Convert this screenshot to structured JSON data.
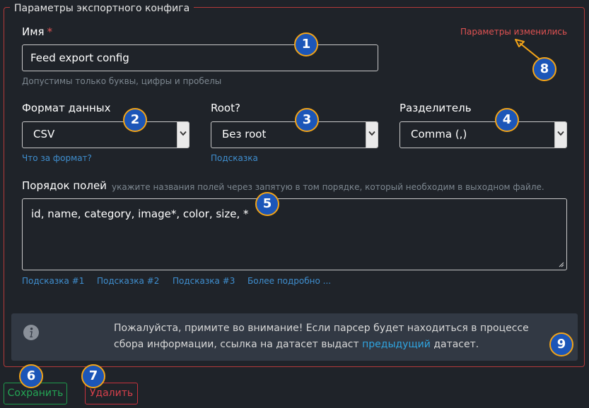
{
  "form": {
    "legend": "Параметры экспортного конфига",
    "changed_notice": "Параметры изменились",
    "name": {
      "label": "Имя",
      "required_mark": "*",
      "value": "Feed export config",
      "help": "Допустимы только буквы, цифры и пробелы"
    },
    "format": {
      "label": "Формат данных",
      "selected": "CSV",
      "help_link": "Что за формат?"
    },
    "root": {
      "label": "Root?",
      "selected": "Без root",
      "help_link": "Подсказка"
    },
    "separator": {
      "label": "Разделитель",
      "selected": "Comma (,)"
    },
    "fields_order": {
      "label": "Порядок полей",
      "hint": "укажите названия полей через запятую в том порядке, который необходим в выходном файле.",
      "value": "id, name, category, image*, color, size, *",
      "hint_links": [
        "Подсказка #1",
        "Подсказка #2",
        "Подсказка #3",
        "Более подробно ..."
      ]
    },
    "notice": {
      "text_before": "Пожалуйста, примите во внимание! Если парсер будет находиться в процессе сбора информации, ссылка на датасет выдаст",
      "link": "предыдущий",
      "text_after": "датасет."
    }
  },
  "actions": {
    "save_label": "Сохранить",
    "delete_label": "Удалить"
  },
  "badges": [
    "1",
    "2",
    "3",
    "4",
    "5",
    "6",
    "7",
    "8",
    "9"
  ],
  "icons": {
    "info": "info-icon",
    "select_arrow": "chevron-down-icon",
    "resize": "resize-grip-icon",
    "pointer": "arrow-icon"
  },
  "colors": {
    "background": "#1f2329",
    "frame_border": "#b33a3a",
    "badge_fill": "#1c56b8",
    "badge_ring": "#f3a418",
    "link": "#3f8fd0",
    "save": "#24a655",
    "delete": "#d6404b",
    "changed": "#e05252"
  }
}
